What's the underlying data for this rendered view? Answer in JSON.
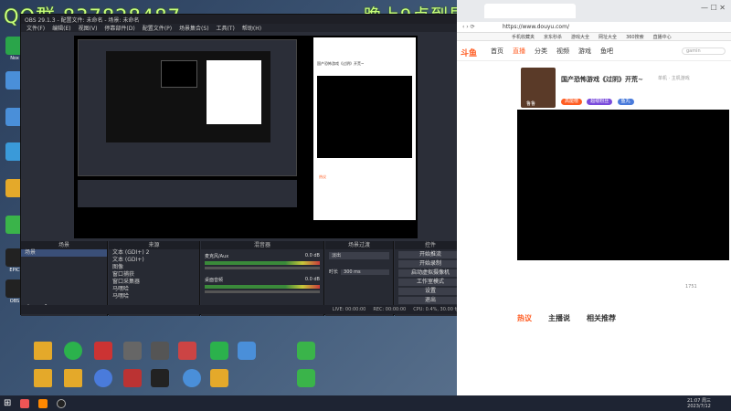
{
  "overlay": {
    "left": "QQ群 837828487",
    "right": "晚上9点到早上5点以后直播"
  },
  "desktop_icons": [
    {
      "label": "Nox",
      "color": "#2aa54a"
    },
    {
      "label": "",
      "color": "#4a8fd9"
    },
    {
      "label": "",
      "color": "#4a8fd9"
    },
    {
      "label": "",
      "color": "#3a9ad9"
    },
    {
      "label": "",
      "color": "#e4a92a"
    },
    {
      "label": "",
      "color": "#3ab44a"
    },
    {
      "label": "EPIC",
      "color": "#222"
    },
    {
      "label": "OBS",
      "color": "#222"
    },
    {
      "label": "",
      "color": "#2bb24c"
    },
    {
      "label": "",
      "color": "#1b2838"
    },
    {
      "label": "",
      "color": "#f0c040"
    }
  ],
  "obs": {
    "title": "OBS 29.1.3 - 配置文件: 未命名 - 场景: 未命名",
    "menu": [
      "文件(F)",
      "编辑(E)",
      "视图(V)",
      "停靠部件(D)",
      "配置文件(P)",
      "场景集合(S)",
      "工具(T)",
      "帮助(H)"
    ],
    "docks": {
      "scenes": {
        "title": "场景",
        "items": [
          "场景"
        ]
      },
      "sources": {
        "title": "来源",
        "items": [
          "文本 (GDI+) 2",
          "文本 (GDI+)",
          "图像",
          "窗口捕获",
          "窗口采集器",
          "马嘿哈",
          "马嘿哈"
        ]
      },
      "mixer": {
        "title": "混音器",
        "tracks": [
          {
            "name": "麦克风/Aux",
            "level": "0.0 dB"
          },
          {
            "name": "桌面音频",
            "level": "0.0 dB"
          }
        ]
      },
      "transitions": {
        "title": "场景过渡",
        "type": "淡出",
        "duration_label": "时长",
        "duration": "300 ms"
      },
      "controls": {
        "title": "控件",
        "buttons": [
          "开始推流",
          "开始录制",
          "启动虚拟摄像机",
          "工作室模式",
          "设置",
          "退出"
        ]
      }
    },
    "status": {
      "live": "LIVE: 00:00:00",
      "rec": "REC: 00:00:00",
      "cpu": "CPU: 0.4%, 30.00 fps"
    }
  },
  "browser": {
    "address": "https://www.douyu.com/",
    "bookmarks": [
      "手机收藏夹",
      "京东秒杀",
      "游戏大全",
      "网址大全",
      "360搜索",
      "直播中心"
    ],
    "logo": "斗鱼",
    "nav": [
      "首页",
      "直播",
      "分类",
      "视频",
      "游戏",
      "鱼吧"
    ],
    "search_placeholder": "gamin",
    "stream_title": "国产恐怖游戏《过阴》开荒~",
    "stream_category": "单机 · 主机游戏",
    "streamer": "鲁鲁",
    "follow_label": "关注",
    "badges": [
      {
        "text": "高能榜",
        "color": "#ff5d23"
      },
      {
        "text": "超级粉丝",
        "color": "#7a4bdb"
      },
      {
        "text": "鱼丸",
        "color": "#4a7bdb"
      }
    ],
    "tabs": [
      "热议",
      "主播说",
      "相关推荐"
    ],
    "count": "1751"
  },
  "taskbar": {
    "time": "21:07 周三",
    "date": "2023/7/12"
  }
}
